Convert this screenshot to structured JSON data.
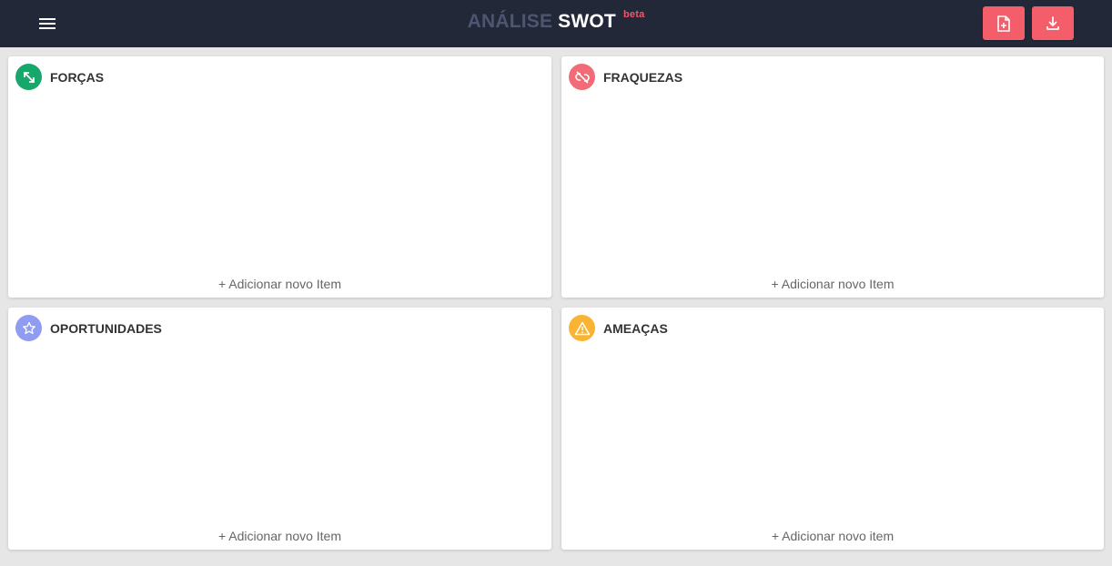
{
  "header": {
    "title_part1": "ANÁLISE",
    "title_part2": "SWOT",
    "beta": "beta",
    "menu_icon": "hamburger-menu-icon",
    "new_icon": "file-add-icon",
    "download_icon": "download-icon"
  },
  "colors": {
    "header_bg": "#232838",
    "accent": "#f45e6a",
    "strengths": "#16a86a",
    "weaknesses": "#f26b77",
    "opportunities": "#8f9cf2",
    "threats": "#f9b434"
  },
  "quadrants": [
    {
      "title": "FORÇAS",
      "icon": "expand-arrows-icon",
      "add_label": "+ Adicionar novo Item"
    },
    {
      "title": "FRAQUEZAS",
      "icon": "broken-link-icon",
      "add_label": "+ Adicionar novo Item"
    },
    {
      "title": "OPORTUNIDADES",
      "icon": "star-icon",
      "add_label": "+ Adicionar novo Item"
    },
    {
      "title": "AMEAÇAS",
      "icon": "warning-icon",
      "add_label": "+ Adicionar novo item"
    }
  ]
}
